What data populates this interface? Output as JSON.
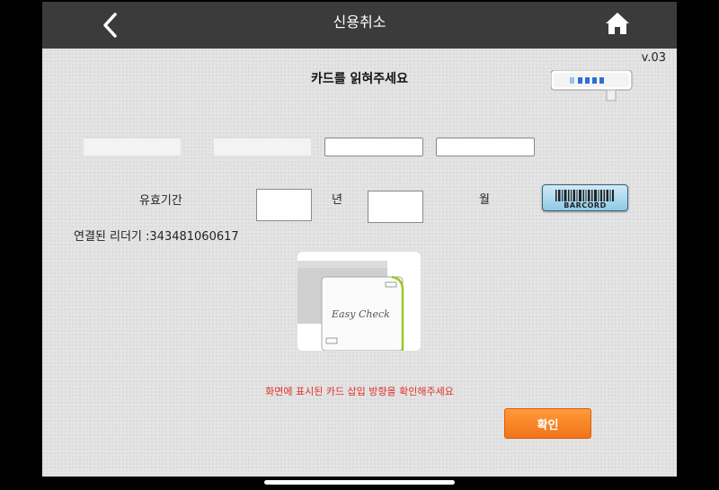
{
  "header": {
    "title": "신용취소"
  },
  "version": "v.03",
  "prompt": "카드를 읽혀주세요",
  "expiry": {
    "label": "유효기간",
    "year_label": "년",
    "month_label": "월"
  },
  "barcode": {
    "label": "BARCORD"
  },
  "reader": {
    "connected_label": "연결된 리더기 :343481060617"
  },
  "card_image": {
    "brand": "Easy Check"
  },
  "notice": "화면에 표시된 카드 삽입 방향을 확인해주세요",
  "confirm_label": "확인",
  "colors": {
    "header": "#3b3b3b",
    "notice": "#e0302a",
    "confirm": "#f2731a"
  },
  "icons": {
    "back": "chevron-left-icon",
    "home": "home-icon",
    "reader": "card-reader-icon",
    "barcode": "barcode-icon"
  }
}
